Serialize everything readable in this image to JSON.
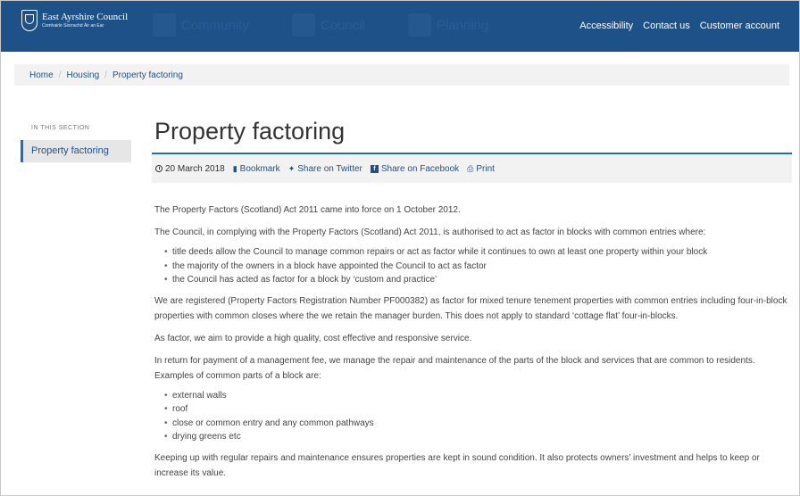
{
  "header": {
    "logo_name": "East Ayrshire Council",
    "logo_sub": "Comhairle Siorrachd Àir an Ear",
    "ghost_nav": [
      "Community",
      "Council",
      "Planning"
    ],
    "util_links": [
      "Accessibility",
      "Contact us",
      "Customer account"
    ]
  },
  "breadcrumb": [
    "Home",
    "Housing",
    "Property factoring"
  ],
  "sidebar": {
    "heading": "IN THIS SECTION",
    "items": [
      "Property factoring"
    ]
  },
  "page": {
    "title": "Property factoring",
    "meta": {
      "date": "20 March 2018",
      "bookmark": "Bookmark",
      "twitter": "Share on Twitter",
      "facebook": "Share on Facebook",
      "print": "Print"
    },
    "p1": "The Property Factors (Scotland) Act 2011 came into force on 1 October 2012.",
    "p2": "The Council, in complying with the Property Factors (Scotland) Act 2011, is authorised to act as factor in blocks with common entries where:",
    "list1": [
      "title deeds allow the Council to manage common repairs or act as factor while it continues to own at least one property within your block",
      "the majority of the owners in a block have appointed the Council to act as factor",
      "the Council has acted as factor for a block by ‘custom and practice’"
    ],
    "p3": "We are registered (Property Factors Registration Number PF000382) as factor for mixed tenure tenement properties with common entries including four-in-block properties with common closes where the we retain the manager burden. This does not apply to standard ‘cottage flat’ four-in-blocks.",
    "p4": "As factor, we aim to provide a high quality, cost effective and responsive service.",
    "p5": "In return for payment of a management fee, we manage the repair and maintenance of the parts of the block and services that are common to residents. Examples of common parts of a block are:",
    "list2": [
      "external walls",
      "roof",
      "close or common entry and any common pathways",
      "drying greens etc"
    ],
    "p6": "Keeping up with regular repairs and maintenance ensures properties are kept in sound condition. It also protects owners’ investment and helps to keep or increase its value."
  },
  "colors": {
    "header": "#1f5189",
    "accent": "#1f6fb5",
    "crumb_bg": "#f2f2f2"
  }
}
